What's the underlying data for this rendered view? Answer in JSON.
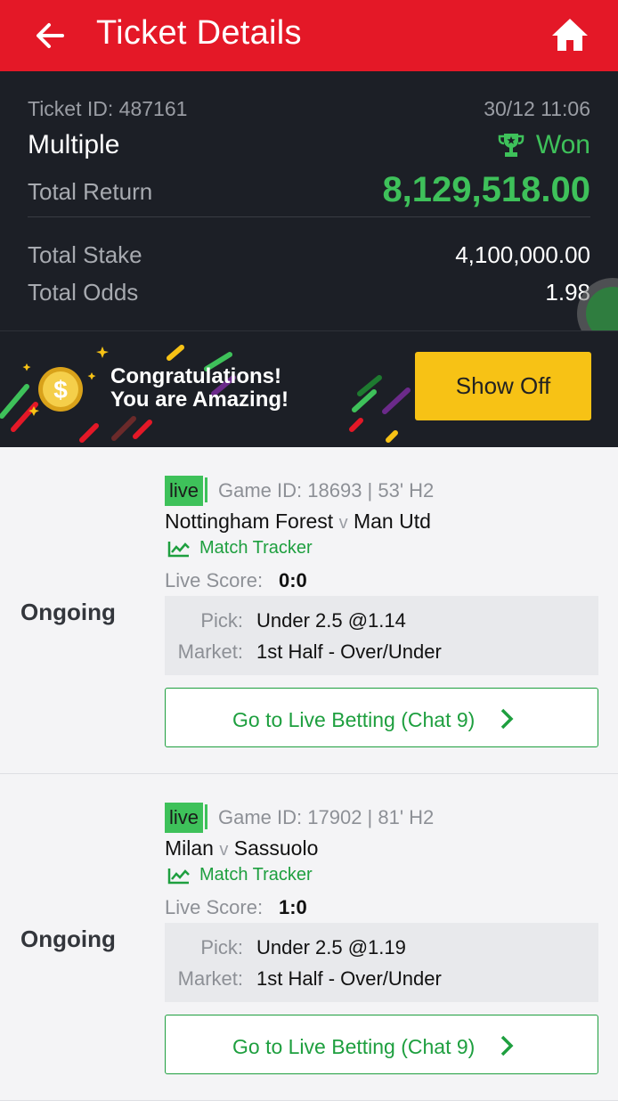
{
  "header": {
    "title": "Ticket Details",
    "back_icon": "arrow-left-icon",
    "home_icon": "home-icon"
  },
  "summary": {
    "ticket_id": "Ticket ID: 487161",
    "datetime": "30/12 11:06",
    "bet_type": "Multiple",
    "status": "Won",
    "status_icon": "trophy-icon",
    "total_return_label": "Total Return",
    "total_return": "8,129,518.00",
    "total_stake_label": "Total Stake",
    "total_stake": "4,100,000.00",
    "total_odds_label": "Total Odds",
    "total_odds": "1.98"
  },
  "banner": {
    "line1": "Congratulations!",
    "line2": "You are Amazing!",
    "coin_icon": "gold-coin-icon",
    "button": "Show Off"
  },
  "legs": [
    {
      "status": "Ongoing",
      "live_badge": "live",
      "game_info": "Game ID: 18693 | 53' H2",
      "home": "Nottingham Forest",
      "vs": "v",
      "away": "Man Utd",
      "tracker": "Match Tracker",
      "score_label": "Live Score:",
      "score": "0:0",
      "pick_label": "Pick:",
      "pick": "Under 2.5 @1.14",
      "market_label": "Market:",
      "market": "1st Half - Over/Under",
      "button": "Go to Live Betting (Chat 9)"
    },
    {
      "status": "Ongoing",
      "live_badge": "live",
      "game_info": "Game ID: 17902 | 81' H2",
      "home": "Milan",
      "vs": "v",
      "away": "Sassuolo",
      "tracker": "Match Tracker",
      "score_label": "Live Score:",
      "score": "1:0",
      "pick_label": "Pick:",
      "pick": "Under 2.5 @1.19",
      "market_label": "Market:",
      "market": "1st Half - Over/Under",
      "button": "Go to Live Betting (Chat 9)"
    }
  ],
  "colors": {
    "header_red": "#e41827",
    "win_green": "#3ec15a",
    "dark_bg": "#1c1f26",
    "button_yellow": "#f7c215"
  }
}
